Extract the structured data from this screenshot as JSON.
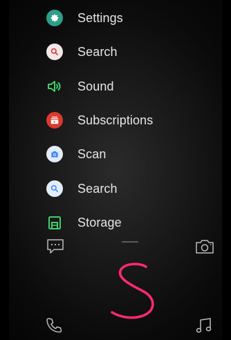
{
  "apps": [
    {
      "label": "Settings",
      "icon": "settings-icon"
    },
    {
      "label": "Search",
      "icon": "search-icon"
    },
    {
      "label": "Sound",
      "icon": "sound-icon"
    },
    {
      "label": "Subscriptions",
      "icon": "subscriptions-icon"
    },
    {
      "label": "Scan",
      "icon": "scan-icon"
    },
    {
      "label": "Search",
      "icon": "search-icon"
    },
    {
      "label": "Storage",
      "icon": "storage-icon"
    }
  ],
  "shortcuts": {
    "messages": "message-icon",
    "camera": "camera-icon",
    "phone": "phone-icon",
    "music": "music-icon"
  },
  "gesture": {
    "letter": "S",
    "color": "#ff2a6d"
  },
  "colors": {
    "settings": "#2e9e8a",
    "search_red": "#f2e7e7",
    "sound": "#3fd06a",
    "subscriptions": "#d93a2f",
    "scan": "#4285f4",
    "search_blue": "#e3ecf9",
    "storage": "#3fd06a"
  }
}
